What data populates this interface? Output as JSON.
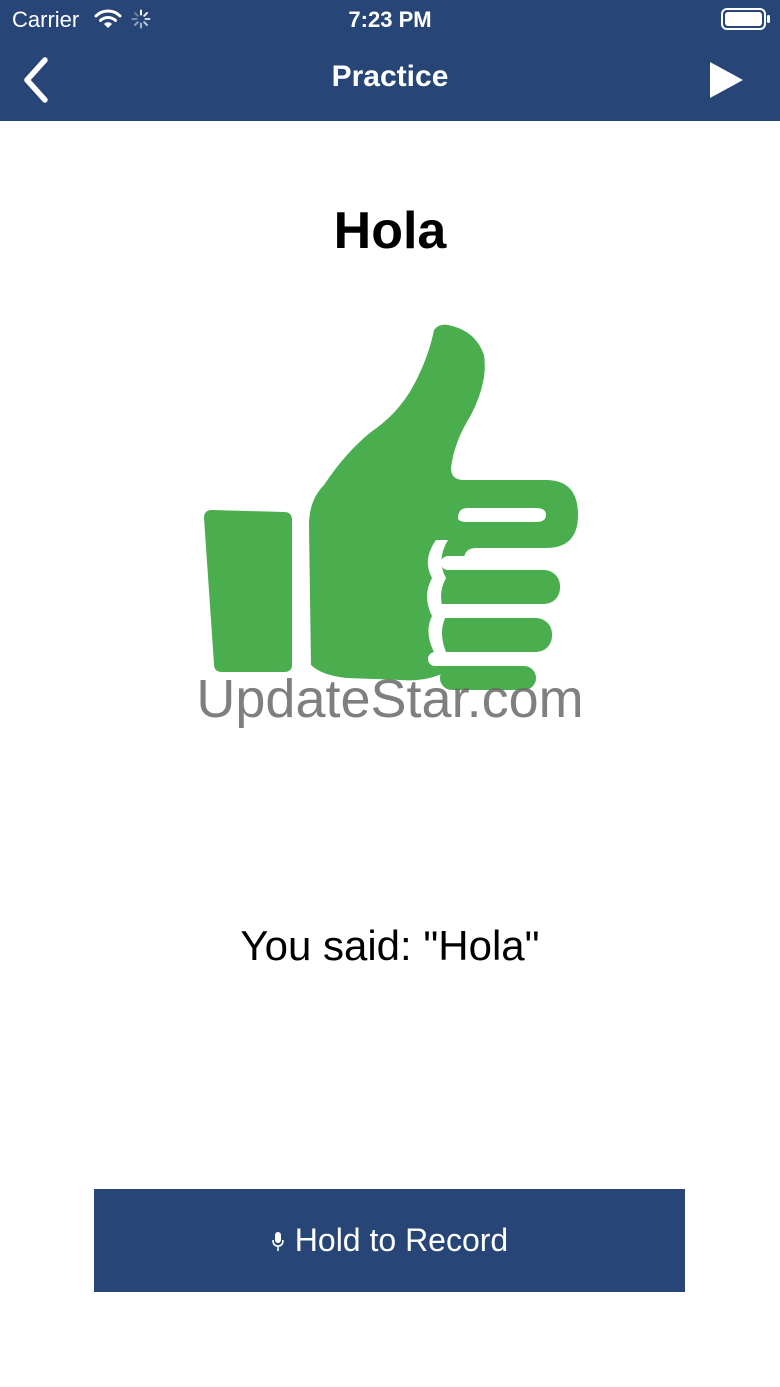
{
  "status_bar": {
    "carrier": "Carrier",
    "time": "7:23 PM",
    "icons": [
      "wifi-icon",
      "activity-spinner-icon",
      "battery-icon"
    ]
  },
  "nav_bar": {
    "title": "Practice",
    "back_icon": "chevron-left-icon",
    "play_icon": "play-icon",
    "background_color": "#274677"
  },
  "main": {
    "word": "Hola",
    "feedback_icon": "thumbs-up-icon",
    "feedback_icon_color": "#4aae4f",
    "watermark": "UpdateStar.com",
    "result_text": "You said: \"Hola\""
  },
  "record_button": {
    "label": "Hold to Record",
    "icon": "microphone-icon",
    "background_color": "#274677"
  }
}
